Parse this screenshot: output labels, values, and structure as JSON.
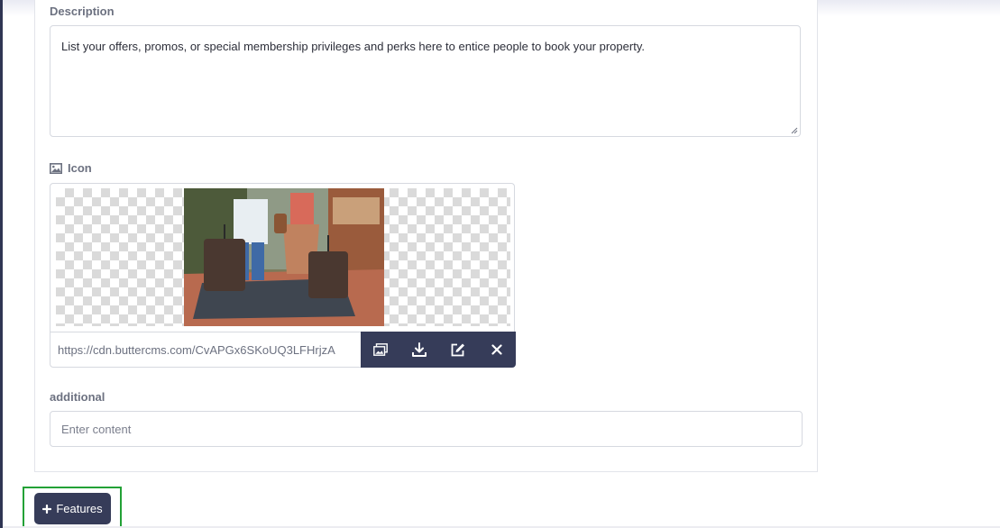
{
  "description": {
    "label": "Description",
    "value": "List your offers, promos, or special membership privileges and perks here to entice people to book your property."
  },
  "icon_field": {
    "label": "Icon",
    "label_icon": "image-icon",
    "url": "https://cdn.buttercms.com/CvAPGx6SKoUQ3LFHrjzA",
    "actions": [
      "media-library-icon",
      "download-icon",
      "edit-icon",
      "close-icon"
    ]
  },
  "additional": {
    "label": "additional",
    "placeholder": "Enter content"
  },
  "add_button": {
    "icon": "plus-icon",
    "label": "Features"
  },
  "colors": {
    "accent_dark": "#363c59",
    "highlight": "#23a136"
  }
}
